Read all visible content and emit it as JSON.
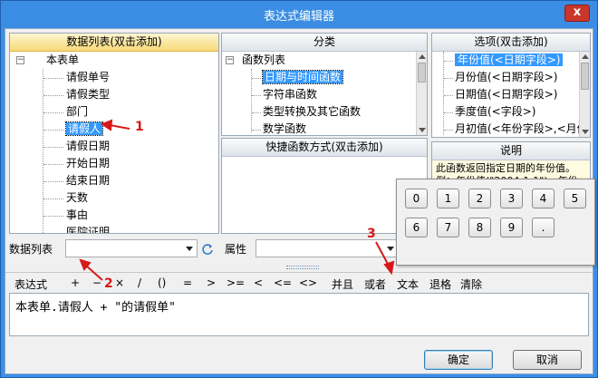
{
  "window": {
    "title": "表达式编辑器",
    "close_glyph": "x"
  },
  "data_list": {
    "header": "数据列表(双击添加)",
    "root": "本表单",
    "root_toggle": "−",
    "items": [
      "请假单号",
      "请假类型",
      "部门",
      "请假人",
      "请假日期",
      "开始日期",
      "结束日期",
      "天数",
      "事由",
      "医院证明"
    ],
    "selected": "请假人"
  },
  "category": {
    "header": "分类",
    "root": "函数列表",
    "root_toggle": "−",
    "items": [
      "日期与时间函数",
      "字符串函数",
      "类型转换及其它函数",
      "数学函数"
    ],
    "selected": "日期与时间函数"
  },
  "options": {
    "header": "选项(双击添加)",
    "items": [
      "年份值(<日期字段>)",
      "月份值(<日期字段>)",
      "日期值(<日期字段>)",
      "季度值(<字段>)",
      "月初值(<年份字段>,<月份"
    ],
    "selected": "年份值(<日期字段>)"
  },
  "shortcut": {
    "header": "快捷函数方式(双击添加)"
  },
  "description": {
    "header": "说明",
    "text": "此函数返回指定日期的年份值。例：年份值(\"2004-1-1\")，年份值(产品消货单.主表.发货日期)"
  },
  "bottom_bar": {
    "datalist_label": "数据列表",
    "property_label": "属性"
  },
  "ops": [
    "表达式",
    "+",
    "−",
    "×",
    "/",
    "()",
    "=",
    ">",
    ">=",
    "<",
    "<=",
    "<>",
    "并且",
    "或者",
    "文本",
    "退格",
    "清除"
  ],
  "editor": {
    "value": "本表单.请假人 + \"的请假单\""
  },
  "keypad": {
    "keys": [
      "0",
      "1",
      "2",
      "3",
      "4",
      "5",
      "6",
      "7",
      "8",
      "9",
      "."
    ]
  },
  "buttons": {
    "ok": "确定",
    "cancel": "取消"
  },
  "annotations": [
    "1",
    "2",
    "3"
  ],
  "colors": {
    "accent": "#3399ff",
    "annotation": "#d81818",
    "title_bar": "#3b8de3"
  }
}
